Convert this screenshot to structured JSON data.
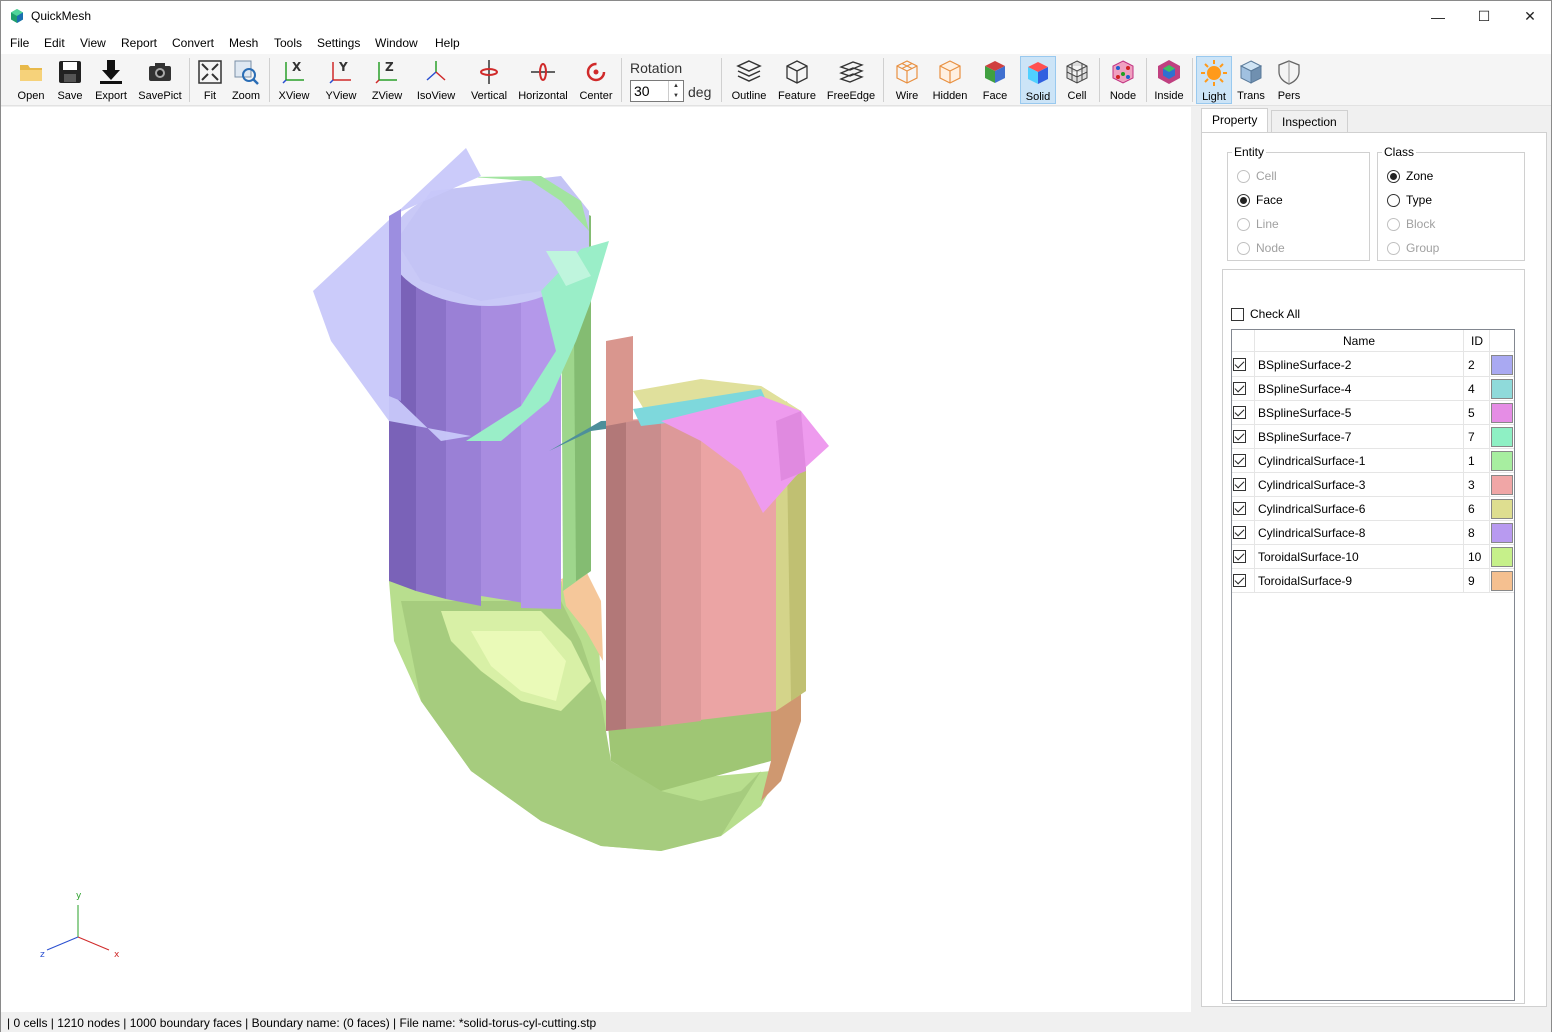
{
  "window": {
    "title": "QuickMesh"
  },
  "menu": [
    "File",
    "Edit",
    "View",
    "Report",
    "Convert",
    "Mesh",
    "Tools",
    "Settings",
    "Window",
    "Help"
  ],
  "toolbar": {
    "buttons": [
      "Open",
      "Save",
      "Export",
      "SavePict",
      "Fit",
      "Zoom",
      "XView",
      "YView",
      "ZView",
      "IsoView",
      "Vertical",
      "Horizontal",
      "Center",
      "Outline",
      "Feature",
      "FreeEdge",
      "Wire",
      "Hidden",
      "Face",
      "Solid",
      "Cell",
      "Node",
      "Inside",
      "Light",
      "Trans",
      "Pers"
    ],
    "rotation_label": "Rotation",
    "rotation_value": "30",
    "rotation_unit": "deg",
    "active": [
      "Solid",
      "Light"
    ]
  },
  "panel": {
    "tabs": [
      "Property",
      "Inspection"
    ],
    "entity": {
      "title": "Entity",
      "options": [
        {
          "label": "Cell",
          "disabled": true,
          "selected": false
        },
        {
          "label": "Face",
          "disabled": false,
          "selected": true
        },
        {
          "label": "Line",
          "disabled": true,
          "selected": false
        },
        {
          "label": "Node",
          "disabled": true,
          "selected": false
        }
      ]
    },
    "class": {
      "title": "Class",
      "options": [
        {
          "label": "Zone",
          "disabled": false,
          "selected": true
        },
        {
          "label": "Type",
          "disabled": false,
          "selected": false
        },
        {
          "label": "Block",
          "disabled": true,
          "selected": false
        },
        {
          "label": "Group",
          "disabled": true,
          "selected": false
        }
      ]
    },
    "check_all": "Check All",
    "columns": {
      "name": "Name",
      "id": "ID"
    },
    "rows": [
      {
        "name": "BSplineSurface-2",
        "id": "2",
        "color": "#a9a9f2"
      },
      {
        "name": "BSplineSurface-4",
        "id": "4",
        "color": "#8fdada"
      },
      {
        "name": "BSplineSurface-5",
        "id": "5",
        "color": "#e58de5"
      },
      {
        "name": "BSplineSurface-7",
        "id": "7",
        "color": "#8ef0c4"
      },
      {
        "name": "CylindricalSurface-1",
        "id": "1",
        "color": "#a7eea0"
      },
      {
        "name": "CylindricalSurface-3",
        "id": "3",
        "color": "#f0a6a6"
      },
      {
        "name": "CylindricalSurface-6",
        "id": "6",
        "color": "#dede90"
      },
      {
        "name": "CylindricalSurface-8",
        "id": "8",
        "color": "#b89af0"
      },
      {
        "name": "ToroidalSurface-10",
        "id": "10",
        "color": "#c6f08a"
      },
      {
        "name": "ToroidalSurface-9",
        "id": "9",
        "color": "#f5c090"
      }
    ]
  },
  "axes": {
    "x": "x",
    "y": "y",
    "z": "z"
  },
  "status": "| 0 cells | 1210 nodes | 1000 boundary faces |  Boundary name:  (0 faces) | File name: *solid-torus-cyl-cutting.stp"
}
